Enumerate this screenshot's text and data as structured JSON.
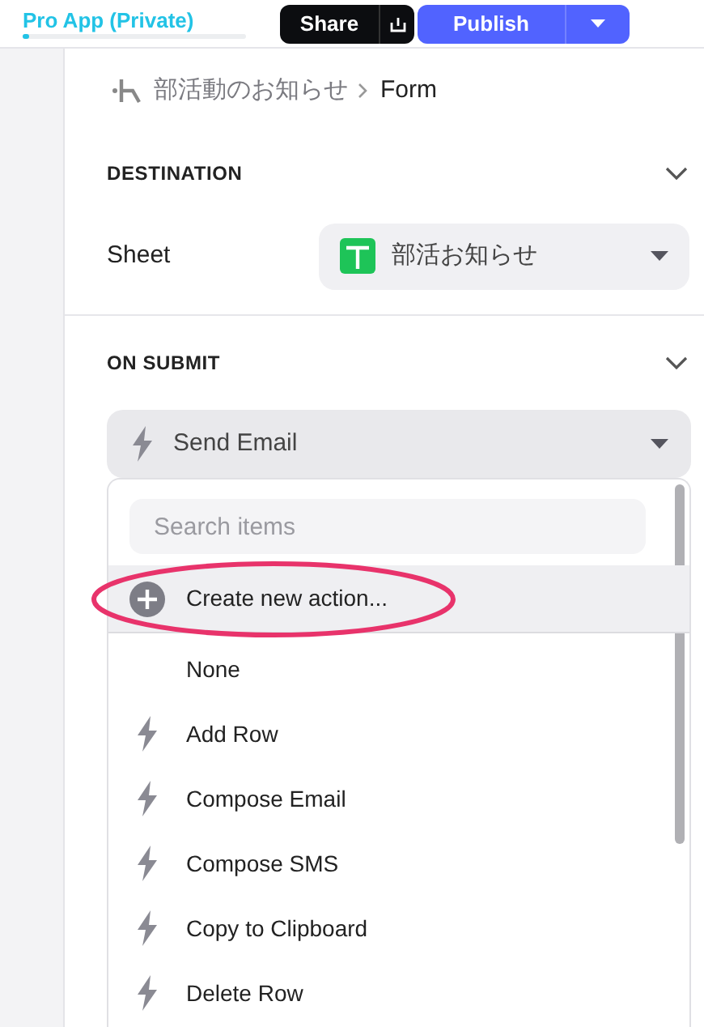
{
  "header": {
    "app_name": "Pro App (Private)",
    "share_button": "Share",
    "publish_button": "Publish"
  },
  "breadcrumb": [
    "部活動のお知らせ",
    "Form"
  ],
  "destination": {
    "title": "DESTINATION",
    "expanded": true,
    "field_label": "Sheet",
    "value": "部活お知らせ"
  },
  "on_submit": {
    "title": "ON SUBMIT",
    "expanded": true,
    "action": "Send Email",
    "dropdown": {
      "search_placeholder": "Search items",
      "items": [
        {
          "kind": "create",
          "label": "Create new action...",
          "selected": true
        },
        {
          "kind": "none",
          "label": "None",
          "selected": false
        },
        {
          "kind": "action",
          "label": "Add Row",
          "selected": false
        },
        {
          "kind": "action",
          "label": "Compose Email",
          "selected": false
        },
        {
          "kind": "action",
          "label": "Compose SMS",
          "selected": false
        },
        {
          "kind": "action",
          "label": "Copy to Clipboard",
          "selected": false
        },
        {
          "kind": "action",
          "label": "Delete Row",
          "selected": false
        }
      ]
    }
  }
}
